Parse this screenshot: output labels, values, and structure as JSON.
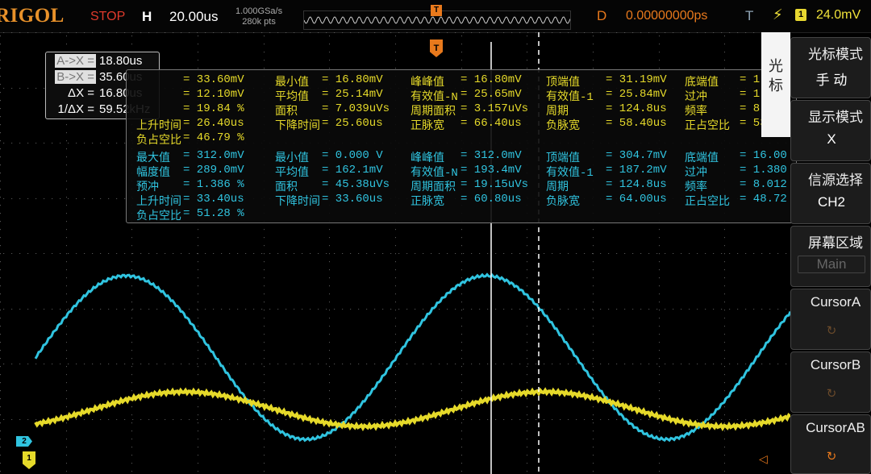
{
  "topbar": {
    "logo": "RIGOL",
    "run_status": "STOP",
    "h_label": "H",
    "timebase": "20.00us",
    "sample_rate": "1.000GSa/s",
    "memory_depth": "280k pts",
    "trigger_marker": "T",
    "d_label": "D",
    "delay": "0.00000000ps",
    "t_label": "T",
    "trigger_channel": "1",
    "trigger_level": "24.0mV"
  },
  "colors": {
    "ch1": "#e6da2a",
    "ch2": "#30c4e0",
    "accent": "#e8791c",
    "stop": "#e03a2c"
  },
  "cursor_readout": {
    "rows": [
      {
        "label": "A->X =",
        "value": "18.80us"
      },
      {
        "label": "B->X =",
        "value": "35.60us"
      },
      {
        "label": "ΔX =",
        "value": "16.80us"
      },
      {
        "label": "1/ΔX =",
        "value": "59.52kHz"
      }
    ]
  },
  "measurements": {
    "ch1": [
      [
        "",
        "= 33.60mV",
        "最小值",
        "= 16.80mV",
        "峰峰值",
        "= 16.80mV",
        "顶端值",
        "= 31.19mV",
        "底端值",
        "= 1"
      ],
      [
        "",
        "= 12.10mV",
        "平均值",
        "= 25.14mV",
        "有效值-N",
        "= 25.65mV",
        "有效值-1",
        "= 25.84mV",
        "过冲",
        "= 1"
      ],
      [
        "",
        "= 19.84 %",
        "面积",
        "= 7.039uVs",
        "周期面积",
        "= 3.157uVs",
        "周期",
        "= 124.8us",
        "频率",
        "= 8"
      ],
      [
        "上升时间",
        "= 26.40us",
        "下降时间",
        "= 25.60us",
        "正脉宽",
        "= 66.40us",
        "负脉宽",
        "= 58.40us",
        "正占空比",
        "= 53"
      ],
      [
        "负占空比",
        "= 46.79 %",
        "",
        "",
        "",
        "",
        "",
        "",
        "",
        ""
      ]
    ],
    "ch2": [
      [
        "最大值",
        "= 312.0mV",
        "最小值",
        "= 0.000 V",
        "峰峰值",
        "= 312.0mV",
        "顶端值",
        "= 304.7mV",
        "底端值",
        "= 16.00"
      ],
      [
        "幅度值",
        "= 289.0mV",
        "平均值",
        "= 162.1mV",
        "有效值-N",
        "= 193.4mV",
        "有效值-1",
        "= 187.2mV",
        "过冲",
        "= 1.380"
      ],
      [
        "预冲",
        "= 1.386 %",
        "面积",
        "= 45.38uVs",
        "周期面积",
        "= 19.15uVs",
        "周期",
        "= 124.8us",
        "频率",
        "= 8.012"
      ],
      [
        "上升时间",
        "= 33.40us",
        "下降时间",
        "= 33.60us",
        "正脉宽",
        "= 60.80us",
        "负脉宽",
        "= 64.00us",
        "正占空比",
        "= 48.72"
      ],
      [
        "负占空比",
        "= 51.28 %",
        "",
        "",
        "",
        "",
        "",
        "",
        "",
        ""
      ]
    ]
  },
  "menu": {
    "title": "光标",
    "items": [
      {
        "title": "光标模式",
        "value": "手 动"
      },
      {
        "title": "显示模式",
        "value": "X"
      },
      {
        "title": "信源选择",
        "value": "CH2"
      },
      {
        "title": "屏幕区域",
        "value": "Main"
      },
      {
        "title": "CursorA",
        "value": ""
      },
      {
        "title": "CursorB",
        "value": ""
      },
      {
        "title": "CursorAB",
        "value": ""
      }
    ]
  },
  "markers": {
    "ch2": "2",
    "ch1": "1",
    "grid_trigger": "T"
  },
  "chart_data": {
    "type": "line",
    "series": [
      {
        "color": "#30c4e0",
        "period_us": 124.8,
        "vmin_mv": 0.0,
        "vmax_mv": 312.0
      },
      {
        "color": "#e6da2a",
        "period_us": 124.8,
        "vmin_mv": 16.8,
        "vmax_mv": 33.6
      }
    ],
    "cursors_us": {
      "A": 18.8,
      "B": 35.6
    }
  }
}
